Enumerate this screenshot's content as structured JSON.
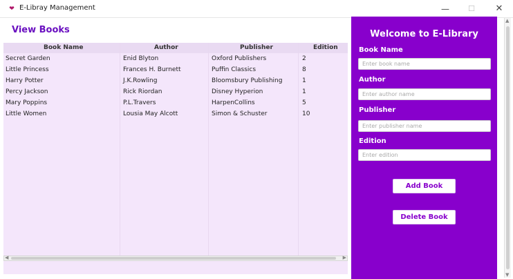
{
  "window": {
    "title": "E-Libray Management",
    "icon": "heart-icon",
    "controls": {
      "minimize": "—",
      "maximize": "☐",
      "close": "✕"
    }
  },
  "view": {
    "title": "View Books",
    "columns": [
      "Book Name",
      "Author",
      "Publisher",
      "Edition"
    ],
    "rows": [
      {
        "name": "Secret Garden",
        "author": "Enid Blyton",
        "publisher": "Oxford Publishers",
        "edition": "2"
      },
      {
        "name": "Little Princess",
        "author": "Frances H. Burnett",
        "publisher": "Puffin Classics",
        "edition": "8"
      },
      {
        "name": "Harry Potter",
        "author": "J.K.Rowling",
        "publisher": "Bloomsbury Publishing",
        "edition": "1"
      },
      {
        "name": "Percy Jackson",
        "author": "Rick Riordan",
        "publisher": "Disney Hyperion",
        "edition": "1"
      },
      {
        "name": "Mary Poppins",
        "author": "P.L.Travers",
        "publisher": "HarpenCollins",
        "edition": "5"
      },
      {
        "name": "Little Women",
        "author": "Lousia May Alcott",
        "publisher": "Simon & Schuster",
        "edition": "10"
      }
    ]
  },
  "form": {
    "welcome": "Welcome to E-Library",
    "book_name_label": "Book Name",
    "book_name_placeholder": "Enter book name",
    "author_label": "Author",
    "author_placeholder": "Enter author name",
    "publisher_label": "Publisher",
    "publisher_placeholder": "Enter publisher name",
    "edition_label": "Edition",
    "edition_placeholder": "Enter edition",
    "add_button": "Add Book",
    "delete_button": "Delete Book"
  },
  "colors": {
    "accent": "#8800cc",
    "title": "#6a10c0",
    "table_bg": "#f4e6fb"
  }
}
